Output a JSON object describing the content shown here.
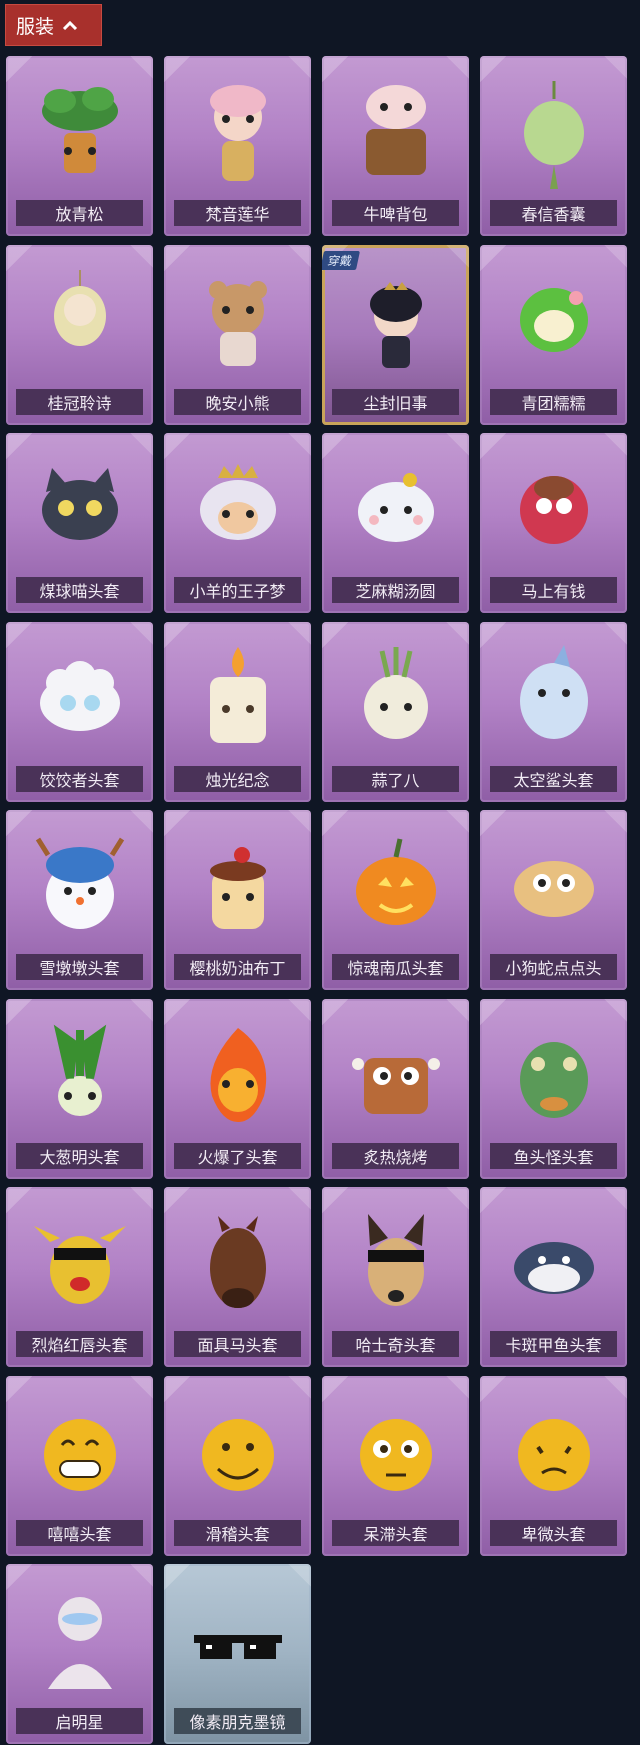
{
  "header": {
    "label": "服装",
    "toggle_icon": "chevron-up-icon"
  },
  "worn_badge": "穿戴",
  "items": [
    {
      "name": "放青松",
      "icon": "bonsai-pine",
      "rarity": "purple"
    },
    {
      "name": "梵音莲华",
      "icon": "character-pendant",
      "rarity": "purple"
    },
    {
      "name": "牛啤背包",
      "icon": "cow-barrel-backpack",
      "rarity": "purple"
    },
    {
      "name": "春信香囊",
      "icon": "green-sachet",
      "rarity": "purple"
    },
    {
      "name": "桂冠聆诗",
      "icon": "laurel-charm",
      "rarity": "purple"
    },
    {
      "name": "晚安小熊",
      "icon": "bear-charm",
      "rarity": "purple"
    },
    {
      "name": "尘封旧事",
      "icon": "doll-charm",
      "rarity": "purple",
      "worn": true
    },
    {
      "name": "青团糯糯",
      "icon": "green-rice-ball",
      "rarity": "purple"
    },
    {
      "name": "煤球喵头套",
      "icon": "black-cat-head",
      "rarity": "purple"
    },
    {
      "name": "小羊的王子梦",
      "icon": "sheep-crown-head",
      "rarity": "purple"
    },
    {
      "name": "芝麻糊汤圆",
      "icon": "dumpling-head",
      "rarity": "purple"
    },
    {
      "name": "马上有钱",
      "icon": "red-horse-head",
      "rarity": "purple"
    },
    {
      "name": "饺饺者头套",
      "icon": "dumpling-cloud-head",
      "rarity": "purple"
    },
    {
      "name": "烛光纪念",
      "icon": "candle-head",
      "rarity": "purple"
    },
    {
      "name": "蒜了八",
      "icon": "garlic-head",
      "rarity": "purple"
    },
    {
      "name": "太空鲨头套",
      "icon": "shark-head",
      "rarity": "purple"
    },
    {
      "name": "雪墩墩头套",
      "icon": "snowman-head",
      "rarity": "purple"
    },
    {
      "name": "樱桃奶油布丁",
      "icon": "pudding-head",
      "rarity": "purple"
    },
    {
      "name": "惊魂南瓜头套",
      "icon": "pumpkin-head",
      "rarity": "purple"
    },
    {
      "name": "小狗蛇点点头",
      "icon": "snake-head",
      "rarity": "purple"
    },
    {
      "name": "大葱明头套",
      "icon": "scallion-head",
      "rarity": "purple"
    },
    {
      "name": "火爆了头套",
      "icon": "fire-head",
      "rarity": "purple"
    },
    {
      "name": "炙热烧烤",
      "icon": "sausage-head",
      "rarity": "purple"
    },
    {
      "name": "鱼头怪头套",
      "icon": "fish-head",
      "rarity": "purple"
    },
    {
      "name": "烈焰红唇头套",
      "icon": "yellow-lips-head",
      "rarity": "purple"
    },
    {
      "name": "面具马头套",
      "icon": "horse-mask-head",
      "rarity": "purple"
    },
    {
      "name": "哈士奇头套",
      "icon": "husky-head",
      "rarity": "purple"
    },
    {
      "name": "卡斑甲鱼头套",
      "icon": "turtle-head",
      "rarity": "purple"
    },
    {
      "name": "嘻嘻头套",
      "icon": "grin-emoji-head",
      "rarity": "purple"
    },
    {
      "name": "滑稽头套",
      "icon": "smirk-emoji-head",
      "rarity": "purple"
    },
    {
      "name": "呆滞头套",
      "icon": "stare-emoji-head",
      "rarity": "purple"
    },
    {
      "name": "卑微头套",
      "icon": "humble-emoji-head",
      "rarity": "purple"
    },
    {
      "name": "启明星",
      "icon": "pale-figure",
      "rarity": "purple"
    },
    {
      "name": "像素朋克墨镜",
      "icon": "pixel-sunglasses",
      "rarity": "blue"
    }
  ]
}
